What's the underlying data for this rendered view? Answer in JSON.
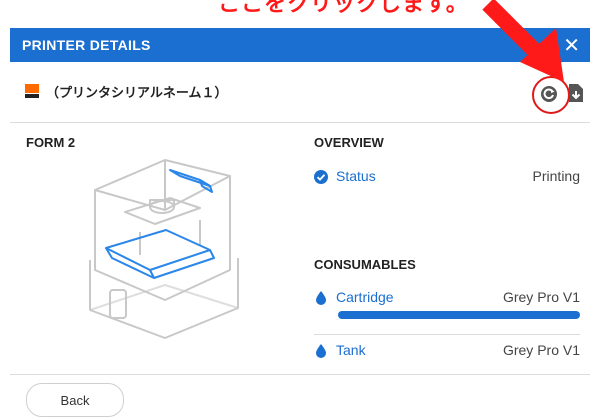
{
  "annotation": {
    "text": "ここをクリックします。",
    "color": "#ff1a1a"
  },
  "header": {
    "title": "PRINTER DETAILS",
    "close_label": "✕",
    "color": "#1b6fd0"
  },
  "printer": {
    "name": "（プリンタシリアルネーム１）",
    "model": "FORM 2"
  },
  "overview": {
    "heading": "OVERVIEW",
    "status_label": "Status",
    "status_value": "Printing"
  },
  "consumables": {
    "heading": "CONSUMABLES",
    "cartridge_label": "Cartridge",
    "cartridge_value": "Grey Pro V1",
    "cartridge_level_percent": 100,
    "tank_label": "Tank",
    "tank_value": "Grey Pro V1"
  },
  "footer": {
    "back_label": "Back"
  },
  "icons": [
    "printer-icon",
    "refresh-icon",
    "document-icon",
    "check-circle-icon",
    "droplet-icon",
    "arrow-icon"
  ]
}
